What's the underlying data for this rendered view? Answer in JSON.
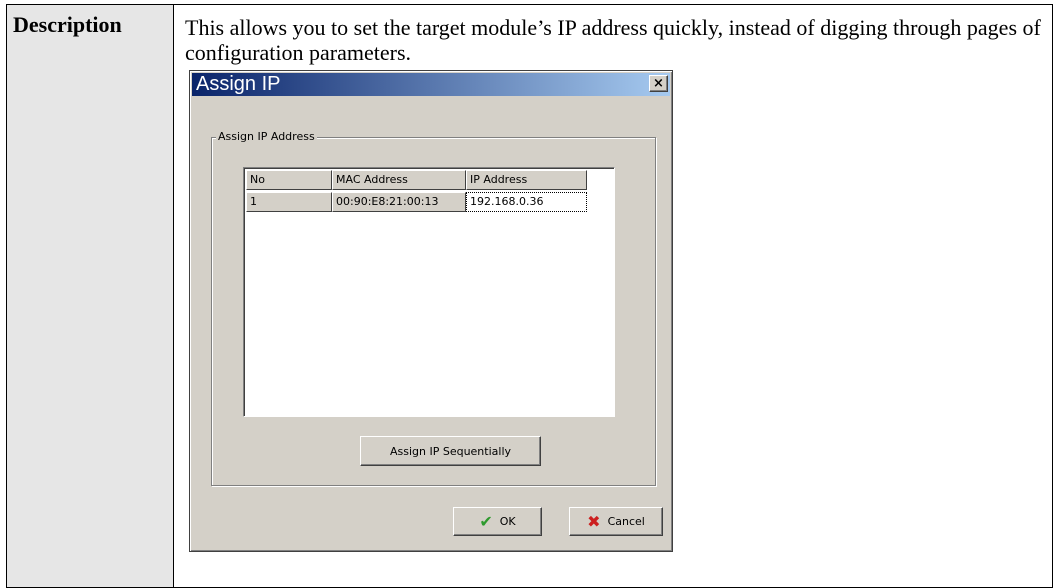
{
  "doc": {
    "label": "Description",
    "text": "This allows you to set the target module’s IP address quickly, instead of digging through pages of configuration parameters."
  },
  "dialog": {
    "title": "Assign IP",
    "close_glyph": "×",
    "group_label": "Assign IP Address",
    "columns": [
      "No",
      "MAC Address",
      "IP Address"
    ],
    "rows": [
      {
        "no": "1",
        "mac": "00:90:E8:21:00:13",
        "ip": "192.168.0.36"
      }
    ],
    "assign_seq_label": "Assign IP Sequentially",
    "ok_label": "OK",
    "cancel_label": "Cancel",
    "ok_icon": "checkmark-icon",
    "cancel_icon": "x-icon",
    "ok_icon_color": "#2e9a2e",
    "cancel_icon_color": "#cc1f1f"
  }
}
